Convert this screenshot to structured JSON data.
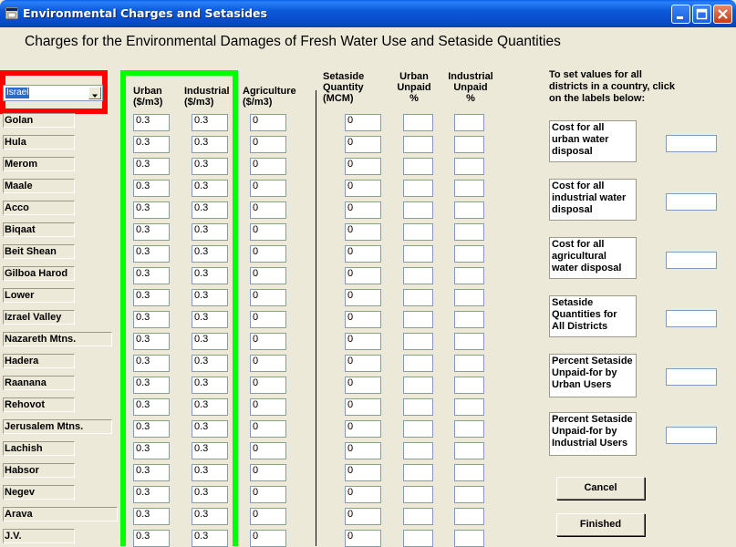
{
  "window": {
    "title": "Environmental Charges and Setasides",
    "icon": "app-icon",
    "controls": [
      "minimize-icon",
      "maximize-icon",
      "close-icon"
    ]
  },
  "heading": "Charges for the Environmental Damages of Fresh Water Use and Setaside Quantities",
  "country_select": {
    "value": "Israel"
  },
  "columns": {
    "urban": [
      "Urban",
      "($/m3)"
    ],
    "industrial": [
      "Industrial",
      "($/m3)"
    ],
    "agriculture": [
      "Agriculture",
      "($/m3)"
    ],
    "setaside": [
      "Setaside",
      "Quantity",
      "(MCM)"
    ],
    "urban_unpaid": [
      "Urban",
      "Unpaid",
      "%"
    ],
    "industrial_unpaid": [
      "Industrial",
      "Unpaid",
      "%"
    ]
  },
  "rows": [
    {
      "district": "Golan",
      "urban": "0.3",
      "industrial": "0.3",
      "agriculture": "0",
      "setaside": "0",
      "urban_unpaid": "",
      "industrial_unpaid": ""
    },
    {
      "district": "Hula",
      "urban": "0.3",
      "industrial": "0.3",
      "agriculture": "0",
      "setaside": "0",
      "urban_unpaid": "",
      "industrial_unpaid": ""
    },
    {
      "district": "Merom",
      "urban": "0.3",
      "industrial": "0.3",
      "agriculture": "0",
      "setaside": "0",
      "urban_unpaid": "",
      "industrial_unpaid": ""
    },
    {
      "district": "Maale",
      "urban": "0.3",
      "industrial": "0.3",
      "agriculture": "0",
      "setaside": "0",
      "urban_unpaid": "",
      "industrial_unpaid": ""
    },
    {
      "district": "Acco",
      "urban": "0.3",
      "industrial": "0.3",
      "agriculture": "0",
      "setaside": "0",
      "urban_unpaid": "",
      "industrial_unpaid": ""
    },
    {
      "district": "Biqaat",
      "urban": "0.3",
      "industrial": "0.3",
      "agriculture": "0",
      "setaside": "0",
      "urban_unpaid": "",
      "industrial_unpaid": ""
    },
    {
      "district": "Beit Shean",
      "urban": "0.3",
      "industrial": "0.3",
      "agriculture": "0",
      "setaside": "0",
      "urban_unpaid": "",
      "industrial_unpaid": ""
    },
    {
      "district": "Gilboa Harod",
      "urban": "0.3",
      "industrial": "0.3",
      "agriculture": "0",
      "setaside": "0",
      "urban_unpaid": "",
      "industrial_unpaid": ""
    },
    {
      "district": "Lower",
      "urban": "0.3",
      "industrial": "0.3",
      "agriculture": "0",
      "setaside": "0",
      "urban_unpaid": "",
      "industrial_unpaid": ""
    },
    {
      "district": "Izrael Valley",
      "urban": "0.3",
      "industrial": "0.3",
      "agriculture": "0",
      "setaside": "0",
      "urban_unpaid": "",
      "industrial_unpaid": ""
    },
    {
      "district": "Nazareth Mtns.",
      "urban": "0.3",
      "industrial": "0.3",
      "agriculture": "0",
      "setaside": "0",
      "urban_unpaid": "",
      "industrial_unpaid": ""
    },
    {
      "district": "Hadera",
      "urban": "0.3",
      "industrial": "0.3",
      "agriculture": "0",
      "setaside": "0",
      "urban_unpaid": "",
      "industrial_unpaid": ""
    },
    {
      "district": "Raanana",
      "urban": "0.3",
      "industrial": "0.3",
      "agriculture": "0",
      "setaside": "0",
      "urban_unpaid": "",
      "industrial_unpaid": ""
    },
    {
      "district": "Rehovot",
      "urban": "0.3",
      "industrial": "0.3",
      "agriculture": "0",
      "setaside": "0",
      "urban_unpaid": "",
      "industrial_unpaid": ""
    },
    {
      "district": "Jerusalem Mtns.",
      "urban": "0.3",
      "industrial": "0.3",
      "agriculture": "0",
      "setaside": "0",
      "urban_unpaid": "",
      "industrial_unpaid": ""
    },
    {
      "district": "Lachish",
      "urban": "0.3",
      "industrial": "0.3",
      "agriculture": "0",
      "setaside": "0",
      "urban_unpaid": "",
      "industrial_unpaid": ""
    },
    {
      "district": "Habsor",
      "urban": "0.3",
      "industrial": "0.3",
      "agriculture": "0",
      "setaside": "0",
      "urban_unpaid": "",
      "industrial_unpaid": ""
    },
    {
      "district": "Negev",
      "urban": "0.3",
      "industrial": "0.3",
      "agriculture": "0",
      "setaside": "0",
      "urban_unpaid": "",
      "industrial_unpaid": ""
    },
    {
      "district": "Arava",
      "urban": "0.3",
      "industrial": "0.3",
      "agriculture": "0",
      "setaside": "0",
      "urban_unpaid": "",
      "industrial_unpaid": ""
    },
    {
      "district": "J.V.",
      "urban": "0.3",
      "industrial": "0.3",
      "agriculture": "0",
      "setaside": "0",
      "urban_unpaid": "",
      "industrial_unpaid": ""
    }
  ],
  "side_panel": {
    "instruction": [
      "To set values for all",
      "districts in a country, click",
      "on the labels below:"
    ],
    "items": [
      {
        "label": [
          "Cost for all",
          "urban water",
          "disposal"
        ],
        "value": ""
      },
      {
        "label": [
          "Cost for all",
          "industrial water",
          "disposal"
        ],
        "value": ""
      },
      {
        "label": [
          "Cost for all",
          "agricultural",
          "water disposal"
        ],
        "value": ""
      },
      {
        "label": [
          "Setaside",
          "Quantities for",
          "All Districts"
        ],
        "value": ""
      },
      {
        "label": [
          "Percent Setaside",
          "Unpaid-for by",
          "Urban Users"
        ],
        "value": ""
      },
      {
        "label": [
          "Percent Setaside",
          "Unpaid-for by",
          "Industrial Users"
        ],
        "value": ""
      }
    ]
  },
  "buttons": {
    "cancel": "Cancel",
    "finished": "Finished"
  },
  "colors": {
    "highlight_red": "#ff0000",
    "highlight_green": "#00ff00",
    "titlebar_blue": "#0b59d9",
    "dialog_bg": "#ece9d8"
  }
}
